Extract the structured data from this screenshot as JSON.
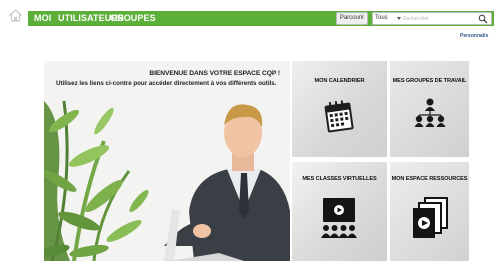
{
  "nav": {
    "items": [
      "MOI",
      "UTILISATEURS",
      "GROUPES"
    ],
    "browse_button": "Parcourir",
    "scope": "Tous",
    "search_placeholder": "Rechercher",
    "accent": "#5cb03a"
  },
  "personalize_link": "Personnalis",
  "hero": {
    "title": "BIENVENUE DANS VOTRE ESPACE CQP !",
    "subtitle": "Utilisez les liens ci-contre pour accéder directement à vos différents outils."
  },
  "tiles": [
    {
      "label": "MON CALENDRIER",
      "icon": "calendar-icon"
    },
    {
      "label": "MES GROUPES DE TRAVAIL",
      "icon": "org-chart-icon"
    },
    {
      "label": "MES CLASSES VIRTUELLES",
      "icon": "virtual-class-icon"
    },
    {
      "label": "MON ESPACE RESSOURCES",
      "icon": "media-stack-icon"
    }
  ]
}
